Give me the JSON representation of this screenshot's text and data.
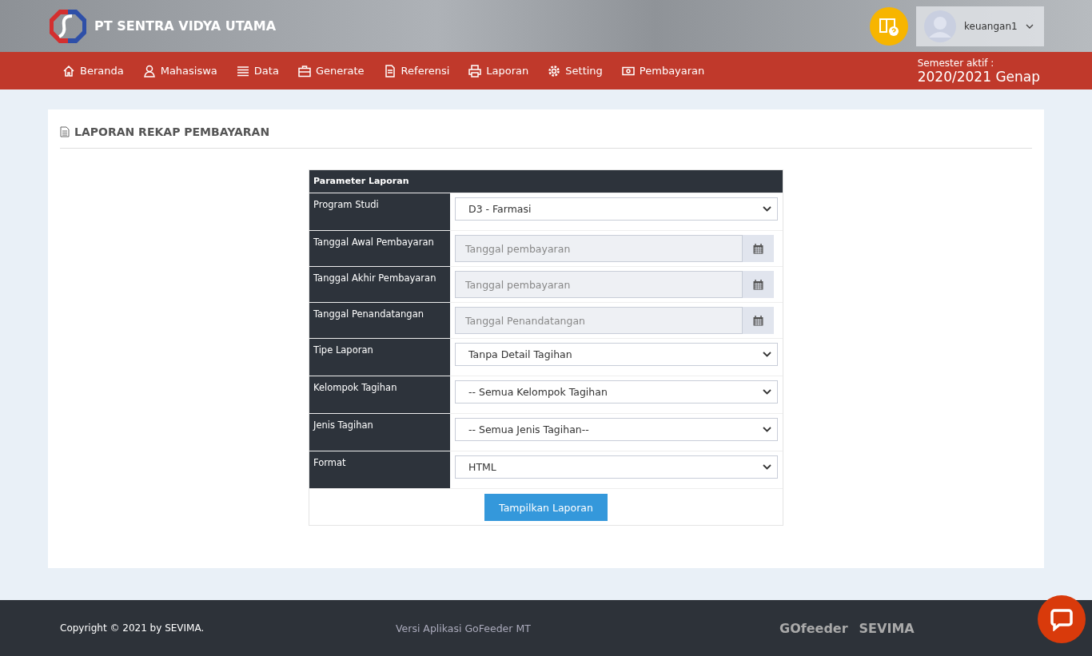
{
  "brand": {
    "name": "PT SENTRA VIDYA UTAMA"
  },
  "user": {
    "name": "keuangan1"
  },
  "nav": [
    {
      "label": "Beranda"
    },
    {
      "label": "Mahasiswa"
    },
    {
      "label": "Data"
    },
    {
      "label": "Generate"
    },
    {
      "label": "Referensi"
    },
    {
      "label": "Laporan"
    },
    {
      "label": "Setting"
    },
    {
      "label": "Pembayaran"
    }
  ],
  "semester": {
    "label": "Semester aktif :",
    "value": "2020/2021 Genap"
  },
  "page_title": "LAPORAN REKAP PEMBAYARAN",
  "form": {
    "heading": "Parameter Laporan",
    "fields": [
      {
        "label": "Program Studi",
        "kind": "select",
        "value": "D3 - Farmasi"
      },
      {
        "label": "Tanggal Awal Pembayaran",
        "kind": "date",
        "placeholder": "Tanggal pembayaran"
      },
      {
        "label": "Tanggal Akhir Pembayaran",
        "kind": "date",
        "placeholder": "Tanggal pembayaran"
      },
      {
        "label": "Tanggal Penandatangan",
        "kind": "date",
        "placeholder": "Tanggal Penandatangan"
      },
      {
        "label": "Tipe Laporan",
        "kind": "select",
        "value": "Tanpa Detail Tagihan"
      },
      {
        "label": "Kelompok Tagihan",
        "kind": "select",
        "value": "-- Semua Kelompok Tagihan"
      },
      {
        "label": "Jenis Tagihan",
        "kind": "select",
        "value": "-- Semua Jenis Tagihan--"
      },
      {
        "label": "Format",
        "kind": "select",
        "value": "HTML"
      }
    ],
    "submit": "Tampilkan Laporan"
  },
  "footer": {
    "copyright": "Copyright © 2021 by SEVIMA.",
    "version": "Versi Aplikasi GoFeeder MT",
    "logos": [
      "GOfeeder",
      "SEVIMA"
    ]
  }
}
